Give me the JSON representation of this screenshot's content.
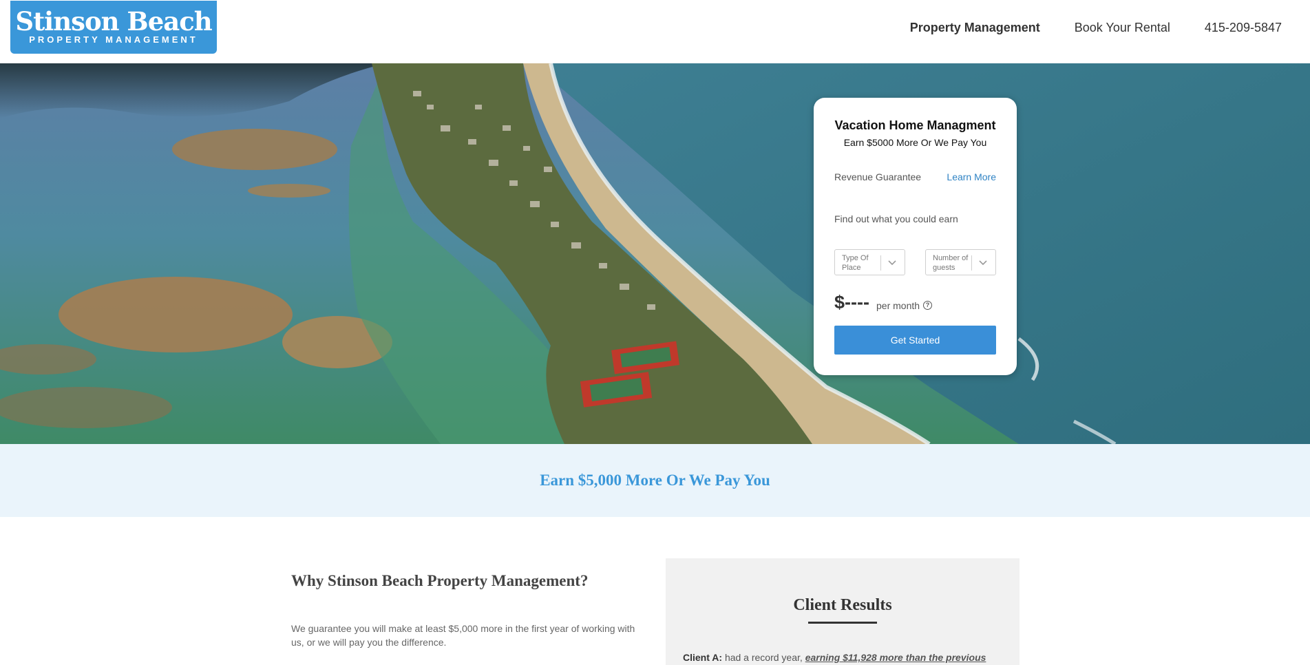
{
  "header": {
    "logo_main": "Stinson Beach",
    "logo_sub": "PROPERTY MANAGEMENT",
    "nav": [
      {
        "label": "Property Management"
      },
      {
        "label": "Book Your Rental"
      },
      {
        "label": "415-209-5847"
      }
    ]
  },
  "card": {
    "title": "Vacation Home Managment",
    "subtitle": "Earn $5000 More Or We Pay You",
    "revenue_label": "Revenue Guarantee",
    "learn_more": "Learn More",
    "find_out": "Find out what you could earn",
    "type_placeholder": "Type Of Place",
    "guests_placeholder": "Number of guests",
    "price": "$----",
    "per_month": "per month",
    "help": "?",
    "cta": "Get Started"
  },
  "banner": {
    "text": "Earn $5,000 More Or We Pay You"
  },
  "why": {
    "title": "Why Stinson Beach Property Management?",
    "body": "We guarantee you will make at least $5,000 more in the first year of working with us, or we will pay you the difference."
  },
  "results": {
    "title": "Client Results",
    "client_a_label": "Client A:",
    "client_a_text": "had a record year,",
    "client_a_highlight": "earning $11,928 more than the previous"
  },
  "colors": {
    "brand_blue": "#3a97d9",
    "button_blue": "#3a8fd8",
    "banner_bg": "#eaf4fb"
  }
}
